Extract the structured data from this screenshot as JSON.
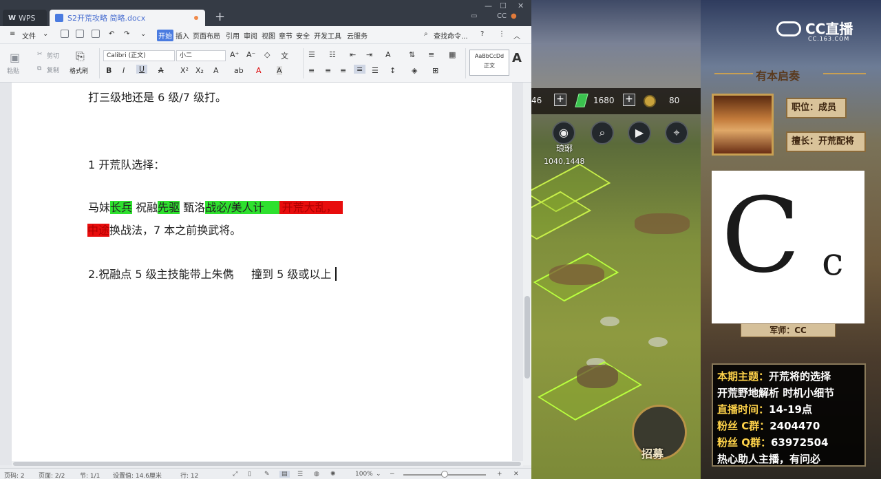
{
  "wps": {
    "app_tab": "WPS",
    "doc_tab": "S2开荒攻略 简略.docx",
    "title_right": [
      "CC"
    ],
    "menu": {
      "file": "文件",
      "tabs": [
        "开始",
        "插入",
        "页面布局",
        "引用",
        "审阅",
        "视图",
        "章节",
        "安全",
        "开发工具",
        "云服务"
      ],
      "search": "查找命令...",
      "help": "?"
    },
    "ribbon": {
      "paste": "粘贴",
      "cut": "剪切",
      "copy": "复制",
      "format_painter": "格式刷",
      "font_name": "Calibri (正文)",
      "font_size": "小二",
      "bold": "B",
      "italic": "I",
      "underline": "U",
      "style_preview": "AaBbCcDd",
      "style_name": "正文"
    },
    "document": {
      "line1": "打三级地还是 6 级/7 级打。",
      "heading1": "1 开荒队选择：",
      "line2_parts": [
        "马妹",
        "长兵",
        " 祝融",
        "先驱",
        " 甄洛",
        "战必/美人计",
        "",
        "开荒大乱，"
      ],
      "line3_parts": [
        "中途",
        "换战法，7 本之前换武将。"
      ],
      "line4": "2.祝融点 5 级主技能带上朱儁     撞到 5 级或以上"
    },
    "status": {
      "page_num": "页码: 2",
      "pages": "页面: 2/2",
      "section": "节: 1/1",
      "setting": "设置值: 14.6厘米",
      "row": "行: 12",
      "zoom": "100%",
      "zoom_level": 0.5
    }
  },
  "game": {
    "res1": "46",
    "res2": "1680",
    "res3": "80",
    "location_name": "琅琊",
    "location_coord": "1040,1448",
    "recruit": "招募"
  },
  "stream": {
    "logo_text": "CC直播",
    "logo_sub": "CC.163.COM",
    "headline": "有本启奏",
    "position": "职位：成员",
    "specialty": "擅长：开荒配将",
    "advisor": "军师：CC",
    "info": [
      {
        "key": "本期主题：",
        "val": "开荒将的选择"
      },
      {
        "key": "",
        "val": "开荒野地解析 时机小细节"
      },
      {
        "key": "直播时间：",
        "val": "14-19点"
      },
      {
        "key": "粉丝 C群：",
        "val": "2404470"
      },
      {
        "key": "粉丝 Q群：",
        "val": "63972504"
      },
      {
        "key": "",
        "val": "热心助人主播，有问必"
      }
    ]
  },
  "colors": {
    "highlight_green": "#2ee02e",
    "highlight_red": "#e80d0d",
    "accent_blue": "#4a7be0"
  }
}
